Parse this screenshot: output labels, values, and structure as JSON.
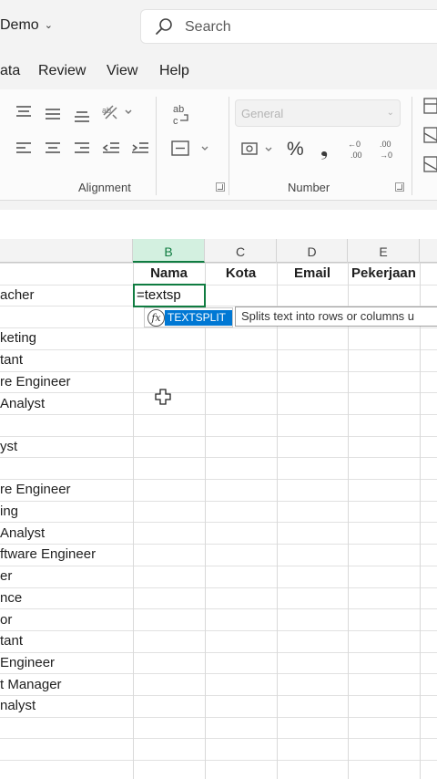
{
  "titlebar": {
    "doc_name": "Demo",
    "search_placeholder": "Search"
  },
  "menu": {
    "tabs": [
      "ata",
      "Review",
      "View",
      "Help"
    ]
  },
  "ribbon": {
    "alignment_label": "Alignment",
    "number_label": "Number",
    "number_format": "General",
    "currency_symbol": "%",
    "comma_symbol": "❟",
    "icons": [
      "align-top-icon",
      "align-middle-icon",
      "align-bottom-icon",
      "orientation-icon",
      "wrap-text-icon",
      "align-left-icon",
      "align-center-icon",
      "align-right-icon",
      "decrease-indent-icon",
      "increase-indent-icon",
      "merge-center-icon",
      "accounting-format-icon",
      "percent-icon",
      "comma-style-icon",
      "increase-decimal-icon",
      "decrease-decimal-icon",
      "conditional-formatting-icon"
    ]
  },
  "grid": {
    "columns": [
      "B",
      "C",
      "D",
      "E"
    ],
    "selected_column": "B",
    "headers": [
      "Nama",
      "Kota",
      "Email",
      "Pekerjaan"
    ],
    "active_cell_input": "=textsp",
    "column_a_values": [
      "acher",
      "",
      "keting",
      "tant",
      "re Engineer",
      "Analyst",
      "",
      "yst",
      "",
      "re Engineer",
      "ing",
      "Analyst",
      "ftware Engineer",
      "er",
      "nce",
      "or",
      "tant",
      "Engineer",
      "t Manager",
      "nalyst"
    ]
  },
  "autocomplete": {
    "function_name": "TEXTSPLIT",
    "fx_label": "fx",
    "tooltip": "Splits text into rows or columns u"
  },
  "colors": {
    "accent_green": "#107c41",
    "selection_blue": "#0078d4"
  }
}
